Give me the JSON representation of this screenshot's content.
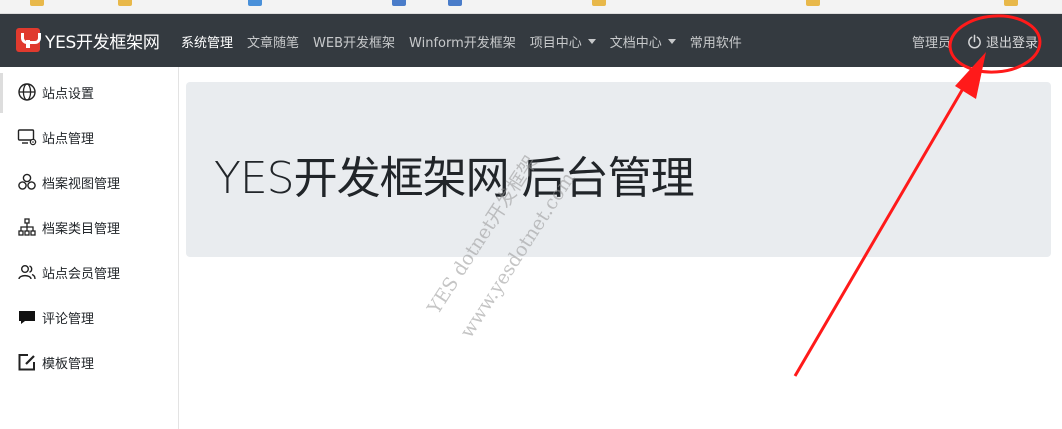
{
  "brand": {
    "name": "YES开发框架网"
  },
  "nav": {
    "items": [
      {
        "label": "系统管理",
        "active": true,
        "dropdown": false
      },
      {
        "label": "文章随笔",
        "active": false,
        "dropdown": false
      },
      {
        "label": "WEB开发框架",
        "active": false,
        "dropdown": false
      },
      {
        "label": "Winform开发框架",
        "active": false,
        "dropdown": false
      },
      {
        "label": "项目中心",
        "active": false,
        "dropdown": true
      },
      {
        "label": "文档中心",
        "active": false,
        "dropdown": true
      },
      {
        "label": "常用软件",
        "active": false,
        "dropdown": false
      }
    ],
    "user": "管理员",
    "logout": "退出登录"
  },
  "sidebar": {
    "items": [
      {
        "label": "站点设置",
        "icon": "globe-icon"
      },
      {
        "label": "站点管理",
        "icon": "monitor-gear-icon"
      },
      {
        "label": "档案视图管理",
        "icon": "circles-icon"
      },
      {
        "label": "档案类目管理",
        "icon": "hierarchy-icon"
      },
      {
        "label": "站点会员管理",
        "icon": "users-icon"
      },
      {
        "label": "评论管理",
        "icon": "comment-icon"
      },
      {
        "label": "模板管理",
        "icon": "edit-icon"
      }
    ]
  },
  "main": {
    "title": "YES开发框架网 后台管理"
  },
  "watermark": {
    "line1": "YES dotnet开发框架",
    "line2": "www.yesdotnet.com"
  },
  "colors": {
    "navbar": "#343a40",
    "jumbotron": "#e9ecef",
    "brand_logo": "#e03a2e",
    "annotation": "#ff1a1a"
  }
}
